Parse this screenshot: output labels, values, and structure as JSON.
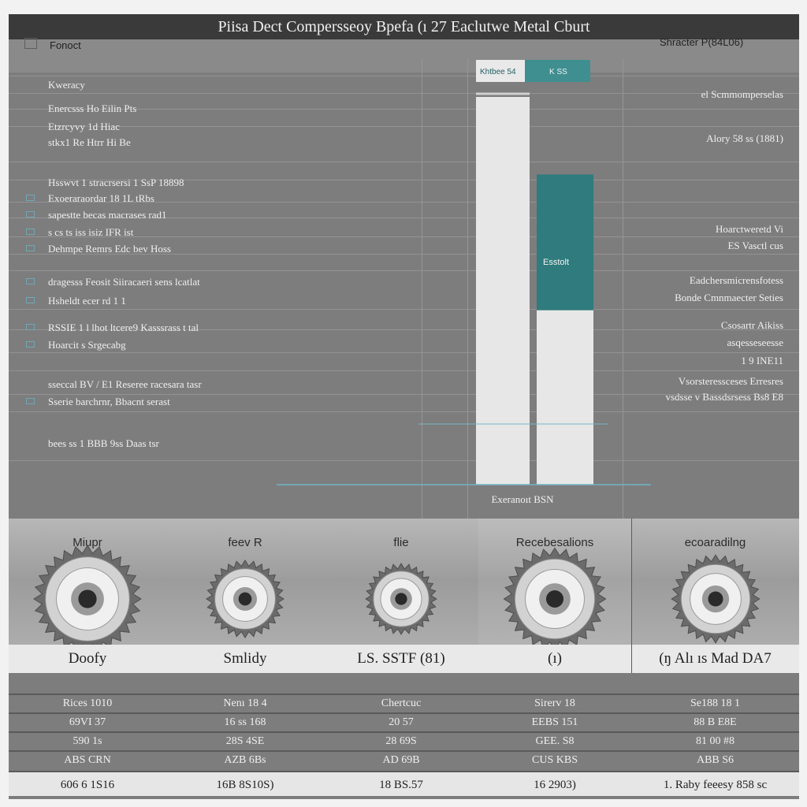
{
  "window": {
    "title": "Piisa Dect Compersseoy Bpefa (ı 27 Eaclutwe Metal Cburt",
    "left_header": "Fonoct",
    "right_header": "Shracter P(84L06)"
  },
  "left_panel": {
    "rows": [
      {
        "text": "",
        "icon": false
      },
      {
        "text": "Kweracy",
        "icon": false
      },
      {
        "text": "Enercsss Ho Eilin Pts",
        "icon": false
      },
      {
        "text": "Etzrcyvy 1d Hiac",
        "icon": false
      },
      {
        "text": "stkx1 Re Htrr Hi Be",
        "icon": false
      },
      {
        "text": "Hsswvt 1 stracrsersi 1 SsP 18898",
        "icon": false
      },
      {
        "text": "Exoeraraordar 18 1L tRbs",
        "icon": true
      },
      {
        "text": "sapestte becas macrases rad1",
        "icon": true
      },
      {
        "text": "s cs ts iss isiz IFR ist",
        "icon": true
      },
      {
        "text": "Dehmpe Remrs Edc bev    Hoss",
        "icon": true
      },
      {
        "text": "dragesss Feosit Siiracaeri sens  lcatlat",
        "icon": true
      },
      {
        "text": "Hsheldt ecer rd 1 1",
        "icon": true
      },
      {
        "text": "RSSIE 1 l lhot ltcere9 Kasssrass t tal",
        "icon": true
      },
      {
        "text": "Hoarcit s Srgecabg",
        "icon": true
      },
      {
        "text": "sseccal BV / E1 Reseree racesara tasr",
        "icon": false
      },
      {
        "text": "Sserie barchrnr, Bbacnt serast",
        "icon": true
      },
      {
        "text": "bees ss 1 BBB 9ss Daas tsr",
        "icon": false
      }
    ]
  },
  "right_panel": {
    "items": [
      "el Scmmomperselas",
      "Alory 58 ss (1881)",
      "Hoarctweretd Vi",
      "ES Vasctl cus",
      "Eadchersmicrensfotess",
      "Bonde Cmnmaecter Seties",
      "Csosartr Aikiss",
      "asqesseseesse",
      "1 9 INE11",
      "Vsorsteressceses Erresres",
      "vsdsse v Bassdsrsess Bs8 E8"
    ]
  },
  "chart_data": {
    "type": "bar",
    "categories": [
      "Khtbee 54",
      "K SS"
    ],
    "series": [
      {
        "name": "Khtbee 54",
        "values": [
          100,
          10
        ]
      },
      {
        "name": "K SS",
        "values": [
          80,
          45
        ]
      }
    ],
    "bar_label": "Esstolt",
    "xlabel": "Exeranoıt BSN",
    "ylim": [
      0,
      100
    ],
    "colors": {
      "light": "#e7e7e7",
      "accent": "#2f7b7d",
      "accent_head": "#3f8f91"
    }
  },
  "gears": [
    {
      "title": "Miupr",
      "label": "Doofy",
      "scale": 1.0
    },
    {
      "title": "feev R",
      "label": "Smlidy",
      "scale": 0.72
    },
    {
      "title": "flie",
      "label": "LS. SSTF (81)",
      "scale": 0.66
    },
    {
      "title": "Recebesalions",
      "label": "(ı)",
      "scale": 0.95
    },
    {
      "title": "ecoaradilng",
      "label": "(ŋ Alı ıs  Mad DA7",
      "scale": 0.82
    }
  ],
  "table": {
    "rows": [
      [
        "Rices 1010",
        "Nenı 18 4",
        "Chertcuc",
        "Sirerv 18",
        "Se188 18 1"
      ],
      [
        "69VI 37",
        "16 ss 168",
        "20 57",
        "EEBS 151",
        "88 B   E8E"
      ],
      [
        "590 1s",
        "28S 4SE",
        "28 69S",
        "GEE. S8",
        "81 00  #8"
      ],
      [
        "ABS CRN",
        "AZB 6Bs",
        "AD 69B",
        "CUS  KBS",
        "ABB  S6"
      ],
      [
        "606 6 1S16",
        "16B 8S10S)",
        "18 BS.57",
        "16 2903)",
        "1. Raby feeesy 858 sc"
      ]
    ]
  }
}
